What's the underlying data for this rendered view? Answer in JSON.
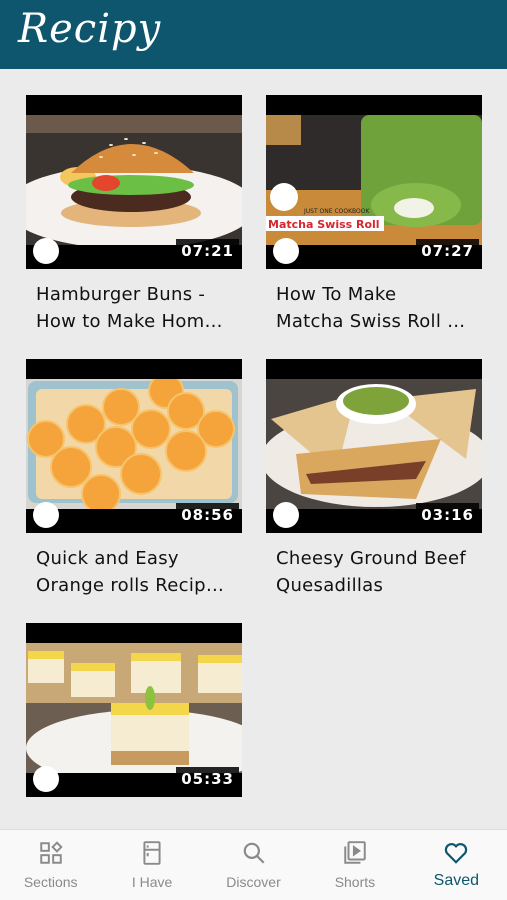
{
  "app": {
    "title": "Recipy"
  },
  "colors": {
    "brand": "#0e566d",
    "background": "#ebebeb",
    "tab_inactive": "#8a8a8a"
  },
  "recipes": [
    {
      "title_line1": "Hamburger Buns -",
      "title_line2": "How to Make Hom…",
      "duration": "07:21",
      "favorited": true
    },
    {
      "title_line1": "How To Make",
      "title_line2": "Matcha Swiss Roll …",
      "duration": "07:27",
      "favorited": true,
      "thumb_brand": "JUST ONE COOKBOOK",
      "thumb_caption": "Matcha Swiss Roll"
    },
    {
      "title_line1": "Quick and Easy",
      "title_line2": "Orange rolls Recip…",
      "duration": "08:56",
      "favorited": true
    },
    {
      "title_line1": "Cheesy Ground Beef",
      "title_line2": "Quesadillas",
      "duration": "03:16",
      "favorited": true
    },
    {
      "title_line1": "",
      "title_line2": "",
      "duration": "05:33",
      "favorited": true
    }
  ],
  "tabs": [
    {
      "label": "Sections",
      "icon": "sections-icon",
      "active": false
    },
    {
      "label": "I Have",
      "icon": "fridge-icon",
      "active": false
    },
    {
      "label": "Discover",
      "icon": "search-icon",
      "active": false
    },
    {
      "label": "Shorts",
      "icon": "shorts-icon",
      "active": false
    },
    {
      "label": "Saved",
      "icon": "heart-icon",
      "active": true
    }
  ]
}
